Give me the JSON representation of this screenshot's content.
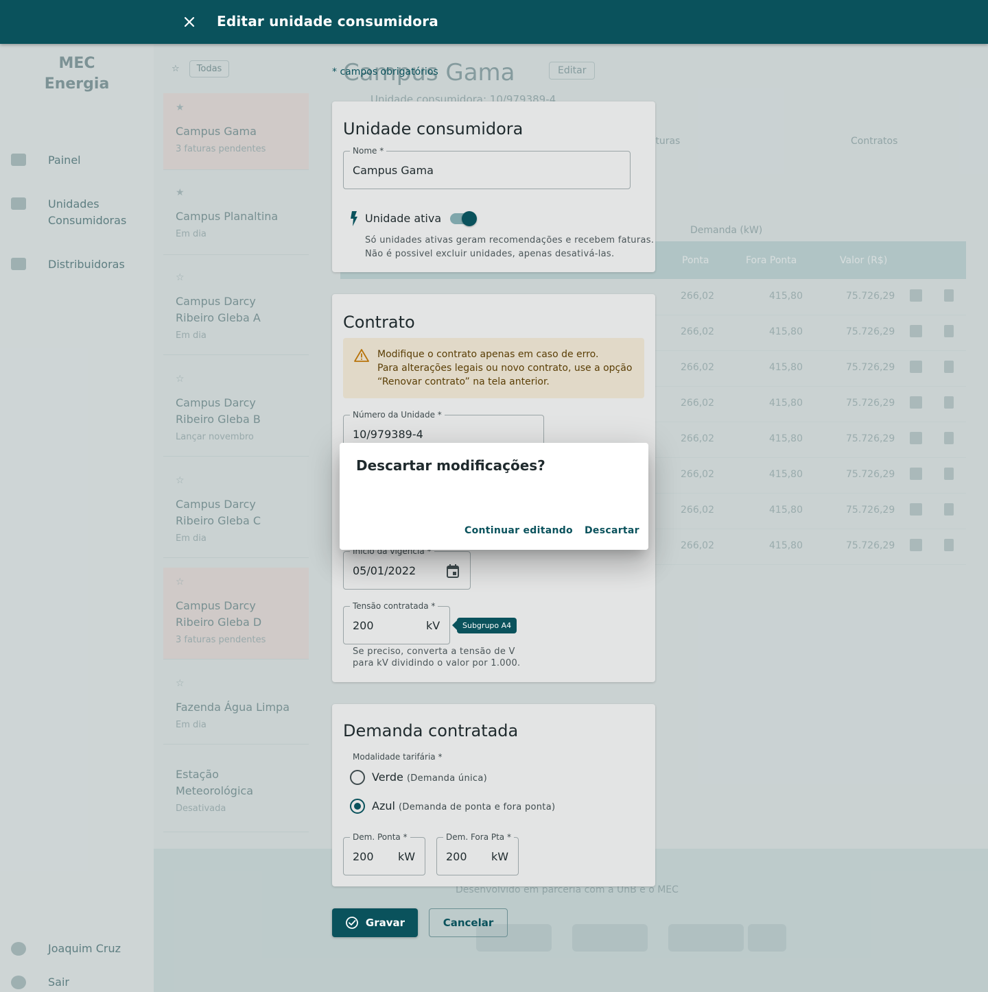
{
  "app_bar": {
    "title": "Editar unidade consumidora"
  },
  "background": {
    "logo": "MEC Energia",
    "nav": [
      "Painel",
      "Unidades Consumidoras",
      "Distribuidoras"
    ],
    "user": "Joaquim Cruz",
    "exit": "Sair",
    "filter": "Todas",
    "units": [
      {
        "name": "Campus Gama",
        "status": "3 faturas pendentes",
        "selected": true
      },
      {
        "name": "Campus Planaltina",
        "status": "Em dia",
        "selected": false
      },
      {
        "name": "Campus Darcy Ribeiro Gleba A",
        "status": "Em dia",
        "selected": false
      },
      {
        "name": "Campus Darcy Ribeiro Gleba B",
        "status": "Lançar novembro",
        "selected": false
      },
      {
        "name": "Campus Darcy Ribeiro Gleba C",
        "status": "Em dia",
        "selected": false
      },
      {
        "name": "Campus Darcy Ribeiro Gleba D",
        "status": "3 faturas pendentes",
        "selected": true
      },
      {
        "name": "Fazenda Água Limpa",
        "status": "Em dia",
        "selected": false
      },
      {
        "name": "Estação Meteorológica",
        "status": "Desativada",
        "selected": false
      }
    ],
    "main_title": "Campus Gama",
    "edit_label": "Editar",
    "subtitle": "Unidade consumidora: 10/979389-4",
    "tab_invoices": "Faturas",
    "tab_contracts": "Contratos",
    "group_label": "Demanda (kW)",
    "col_ponta": "Ponta",
    "col_fora_ponta": "Fora Ponta",
    "col_valor": "Valor (R$)",
    "row": {
      "ponta": "266,02",
      "fora": "415,80",
      "valor": "75.726,29"
    },
    "footer_text": "Desenvolvido em parceria com a UnB e o MEC"
  },
  "form": {
    "required_note": "* campos obrigatórios",
    "unit_card": {
      "title": "Unidade consumidora",
      "name_label": "Nome *",
      "name_value": "Campus Gama",
      "active_label": "Unidade ativa",
      "active": true,
      "helper_1": "Só unidades ativas geram recomendações e recebem faturas.",
      "helper_2": "Não é possivel excluir unidades, apenas desativá-las."
    },
    "contract_card": {
      "title": "Contrato",
      "warning_1": "Modifique o contrato apenas em caso de erro.",
      "warning_2": "Para alterações legais ou novo contrato, use a opção",
      "warning_3": "“Renovar contrato” na tela anterior.",
      "unit_number_label": "Número da Unidade *",
      "unit_number_value": "10/979389-4",
      "start_label": "Início da vigência *",
      "start_value": "05/01/2022",
      "voltage_label": "Tensão contratada *",
      "voltage_value": "200",
      "voltage_unit": "kV",
      "subgroup_badge": "Subgrupo A4",
      "voltage_helper_1": "Se preciso, converta a tensão de V",
      "voltage_helper_2": "para kV dividindo o valor por 1.000."
    },
    "demand_card": {
      "title": "Demanda contratada",
      "modality_label": "Modalidade tarifária *",
      "option_green": "Verde",
      "option_green_hint": "(Demanda única)",
      "option_blue": "Azul",
      "option_blue_hint": "(Demanda de ponta e fora ponta)",
      "selected": "Azul",
      "peak_label": "Dem. Ponta *",
      "peak_value": "200",
      "peak_unit": "kW",
      "offpeak_label": "Dem. Fora Pta *",
      "offpeak_value": "200",
      "offpeak_unit": "kW"
    },
    "save_label": "Gravar",
    "cancel_label": "Cancelar"
  },
  "dialog": {
    "title": "Descartar modificações?",
    "continue_label": "Continuar editando",
    "discard_label": "Descartar"
  },
  "colors": {
    "primary": "#0a525c",
    "warning_bg": "#e1d9c8",
    "warning_text": "#5a3e05"
  }
}
